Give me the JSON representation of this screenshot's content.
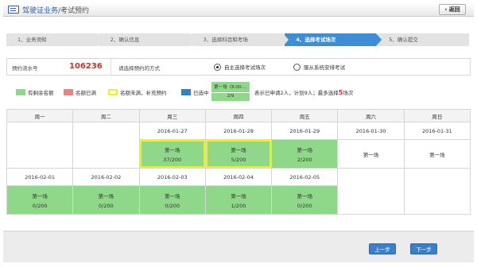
{
  "header": {
    "title": "驾驶证业务",
    "subtitle": "/考试预约",
    "back_label": "返回"
  },
  "steps": [
    {
      "label": "1、业务须知"
    },
    {
      "label": "2、确认信息"
    },
    {
      "label": "3、选择科目和考场"
    },
    {
      "label": "4、选择考试场次"
    },
    {
      "label": "5、确认提交"
    }
  ],
  "active_step": 3,
  "info": {
    "serial_label": "预约流水号",
    "serial_value": "106236",
    "mode_label": "请选择预约的方式",
    "mode_options": [
      {
        "label": "自主选择考试场次",
        "selected": true
      },
      {
        "label": "服从系统安排考试",
        "selected": false
      }
    ]
  },
  "legend": {
    "items": [
      {
        "label": "有剩余名额",
        "color": "#8fd88a"
      },
      {
        "label": "名额已满",
        "color": "#e88484"
      },
      {
        "label": "名额未满，补充预约",
        "color": "#eef021"
      },
      {
        "label": "已选中",
        "color": "#2f82c8"
      }
    ],
    "sample_top": "第一场（8:00-…",
    "sample_bottom": "2/9",
    "note_prefix": "表示已申请2人，计划9人；最多选择",
    "note_count": "5",
    "note_suffix": "场次"
  },
  "calendar": {
    "weekdays": [
      "周一",
      "周二",
      "周三",
      "周四",
      "周五",
      "周六",
      "周日"
    ],
    "weeks": [
      {
        "dates": [
          "",
          "",
          "2016-01-27",
          "2016-01-28",
          "2016-01-29",
          "2016-01-30",
          "2016-01-31"
        ],
        "slots": [
          null,
          null,
          {
            "name": "第一场",
            "capacity": "37/200",
            "style": "yellow"
          },
          {
            "name": "第一场",
            "capacity": "5/200",
            "style": "yellow"
          },
          {
            "name": "第一场",
            "capacity": "2/200",
            "style": "green"
          },
          {
            "name": "第一场",
            "capacity": "",
            "style": "plain"
          },
          {
            "name": "第一场",
            "capacity": "",
            "style": "plain"
          }
        ]
      },
      {
        "dates": [
          "2016-02-01",
          "2016-02-02",
          "2016-02-03",
          "2016-02-04",
          "2016-02-05",
          "",
          ""
        ],
        "slots": [
          {
            "name": "第一场",
            "capacity": "0/200",
            "style": "green"
          },
          {
            "name": "第一场",
            "capacity": "0/200",
            "style": "green"
          },
          {
            "name": "第一场",
            "capacity": "0/200",
            "style": "green"
          },
          {
            "name": "第一场",
            "capacity": "1/200",
            "style": "green"
          },
          {
            "name": "第一场",
            "capacity": "0/200",
            "style": "green"
          },
          null,
          null
        ]
      }
    ]
  },
  "footer": {
    "prev_label": "上一步",
    "next_label": "下一步"
  }
}
